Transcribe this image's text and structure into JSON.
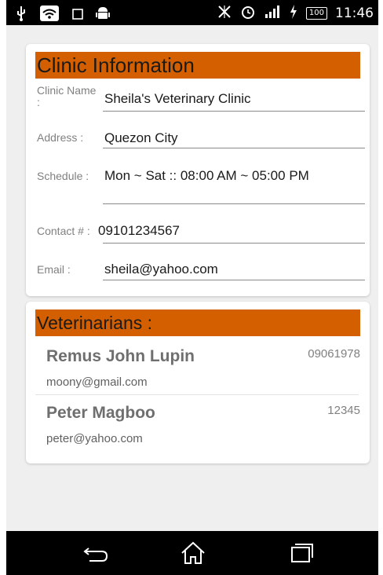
{
  "status_bar": {
    "battery": "100",
    "time": "11:46",
    "icons": [
      "usb-icon",
      "wifi-icon",
      "square-icon",
      "android-icon",
      "vibrate-off-icon",
      "alarm-icon",
      "signal-icon",
      "charging-icon",
      "battery-icon"
    ]
  },
  "clinic": {
    "title": "Clinic Information",
    "fields": [
      {
        "label": "Clinic Name :",
        "value": "Sheila's Veterinary Clinic"
      },
      {
        "label": "Address :",
        "value": "Quezon City"
      },
      {
        "label": "Schedule :",
        "value": "Mon ~ Sat :: 08:00 AM ~ 05:00 PM"
      },
      {
        "label": "Contact # :",
        "value": "09101234567"
      },
      {
        "label": "Email :",
        "value": "sheila@yahoo.com"
      }
    ]
  },
  "veterinarians": {
    "title": "Veterinarians :",
    "items": [
      {
        "name": "Remus John Lupin",
        "email": "moony@gmail.com",
        "phone": "09061978"
      },
      {
        "name": "Peter Magboo",
        "email": "peter@yahoo.com",
        "phone": "12345"
      }
    ]
  },
  "nav": {
    "icons": [
      "back-icon",
      "home-icon",
      "recents-icon"
    ]
  },
  "colors": {
    "accent": "#d35f00",
    "background": "#efefef",
    "card": "#ffffff"
  }
}
